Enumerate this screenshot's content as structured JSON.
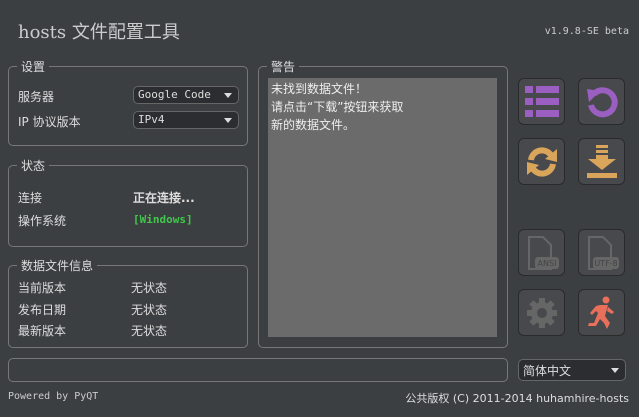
{
  "header": {
    "title": "hosts 文件配置工具",
    "version": "v1.9.8-SE beta"
  },
  "settings": {
    "title": "设置",
    "server_label": "服务器",
    "server_value": "Google Code",
    "ip_label": "IP 协议版本",
    "ip_value": "IPv4"
  },
  "status": {
    "title": "状态",
    "conn_label": "连接",
    "conn_value": "正在连接...",
    "os_label": "操作系统",
    "os_value": "[Windows]",
    "os_color": "#3fc84a"
  },
  "datafile": {
    "title": "数据文件信息",
    "rows": [
      {
        "label": "当前版本",
        "value": "无状态"
      },
      {
        "label": "发布日期",
        "value": "无状态"
      },
      {
        "label": "最新版本",
        "value": "无状态"
      }
    ]
  },
  "warning": {
    "title": "警告",
    "lines": [
      "未找到数据文件！",
      "请点击“下载”按钮来获取",
      "新的数据文件。"
    ]
  },
  "buttons": {
    "ansi": "ANSI",
    "utf8": "UTF-8"
  },
  "language": {
    "value": "简体中文"
  },
  "footer": {
    "left": "Powered by PyQT",
    "right": "公共版权 (C) 2011-2014 huhamhire-hosts"
  }
}
